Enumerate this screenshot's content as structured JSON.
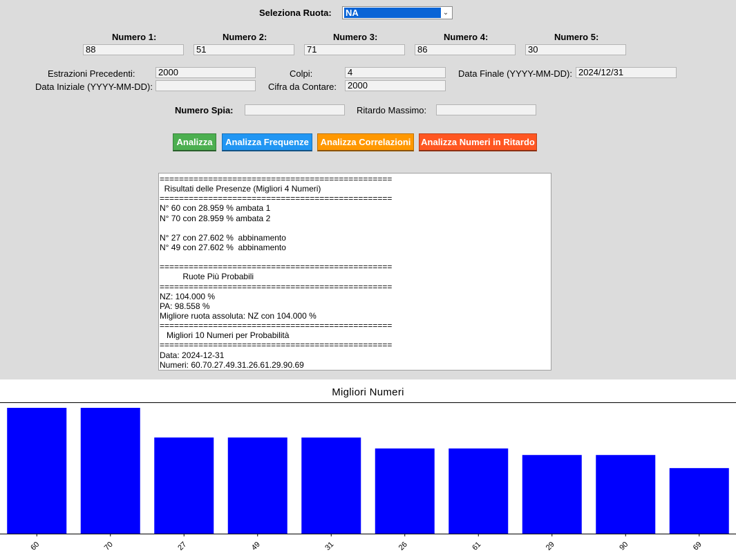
{
  "wheel": {
    "label": "Seleziona Ruota:",
    "selected": "NA"
  },
  "numbers": [
    {
      "label": "Numero 1:",
      "value": "88"
    },
    {
      "label": "Numero 2:",
      "value": "51"
    },
    {
      "label": "Numero 3:",
      "value": "71"
    },
    {
      "label": "Numero 4:",
      "value": "86"
    },
    {
      "label": "Numero 5:",
      "value": "30"
    }
  ],
  "params": {
    "estrazioni": {
      "label": "Estrazioni Precedenti:",
      "value": "2000"
    },
    "data_iniziale": {
      "label": "Data Iniziale (YYYY-MM-DD):",
      "value": ""
    },
    "colpi": {
      "label": "Colpi:",
      "value": "4"
    },
    "cifra": {
      "label": "Cifra da Contare:",
      "value": "2000"
    },
    "data_finale": {
      "label": "Data Finale (YYYY-MM-DD):",
      "value": "2024/12/31"
    },
    "numero_spia": {
      "label": "Numero Spia:",
      "value": ""
    },
    "ritardo_massimo": {
      "label": "Ritardo Massimo:",
      "value": ""
    }
  },
  "buttons": {
    "analizza": {
      "label": "Analizza",
      "color": "#4caf50"
    },
    "frequenze": {
      "label": "Analizza Frequenze",
      "color": "#2196f3"
    },
    "correlazioni": {
      "label": "Analizza Correlazioni",
      "color": "#ff9800"
    },
    "ritardo": {
      "label": "Analizza Numeri in Ritardo",
      "color": "#ff5722"
    }
  },
  "results": {
    "lines": [
      "================================================",
      "  Risultati delle Presenze (Migliori 4 Numeri)",
      "================================================",
      "N° 60 con 28.959 % ambata 1",
      "N° 70 con 28.959 % ambata 2",
      "",
      "N° 27 con 27.602 %  abbinamento",
      "N° 49 con 27.602 %  abbinamento",
      "",
      "================================================",
      "          Ruote Più Probabili",
      "================================================",
      "NZ: 104.000 %",
      "PA: 98.558 %",
      "Migliore ruota assoluta: NZ con 104.000 %",
      "================================================",
      "   Migliori 10 Numeri per Probabilità",
      "================================================",
      "Data: 2024-12-31",
      "Numeri: 60.70.27.49.31.26.61.29.90.69"
    ]
  },
  "chart_data": {
    "type": "bar",
    "title": "Migliori Numeri",
    "categories": [
      "60",
      "70",
      "27",
      "49",
      "31",
      "26",
      "61",
      "29",
      "90",
      "69"
    ],
    "values": [
      28.959,
      28.959,
      27.602,
      27.602,
      27.6,
      27.1,
      27.1,
      26.8,
      26.8,
      26.2
    ],
    "bar_color": "#0000ff",
    "grid": false
  }
}
